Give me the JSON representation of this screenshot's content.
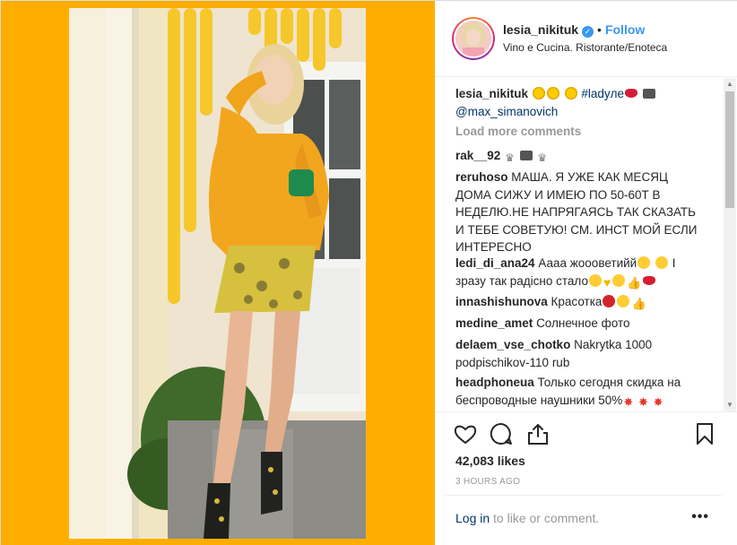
{
  "post": {
    "username": "lesia_nikituk",
    "follow_label": "Follow",
    "separator": "•",
    "location": "Vino e Cucina. Ristorante/Enoteca",
    "caption": {
      "username": "lesia_nikituk",
      "hashtag": "#ladyле",
      "mention": "@max_simanovich"
    },
    "load_more": "Load more comments",
    "comments": [
      {
        "user": "rak__92",
        "text": ""
      },
      {
        "user": "reruhoso",
        "text": "МАША. Я УЖЕ КАК МЕСЯЦ ДОМА СИЖУ И ИМЕЮ ПО 50-60Т В НЕДЕЛЮ.НЕ НАПРЯГАЯСЬ ТАК СКАЗАТЬ И ТЕБЕ СОВЕТУЮ! СМ. ИНСТ МОЙ ЕСЛИ ИНТЕРЕСНО"
      },
      {
        "user": "ledi_di_ana24",
        "text": "Аааа жоооветийй",
        "text2": "І зразу так радісно стало"
      },
      {
        "user": "innashishunova",
        "text": "Красотка"
      },
      {
        "user": "medine_amet",
        "text": "Солнечное фото"
      },
      {
        "user": "delaem_vse_chotko",
        "text": "Nakrytka 1000 podpischikov-110 rub"
      },
      {
        "user": "headphoneua",
        "text": "Только сегодня скидка на беспроводные наушники 50%"
      }
    ],
    "likes": "42,083 likes",
    "time": "3 HOURS AGO",
    "login_link": "Log in",
    "login_rest": " to like or comment.",
    "more_label": "•••"
  },
  "icons": {
    "verified": "verified-badge-icon",
    "like": "heart-icon",
    "comment": "comment-icon",
    "share": "share-icon",
    "save": "bookmark-icon",
    "more": "more-options-icon"
  },
  "colors": {
    "media_background": "#ffae00",
    "accent_blue": "#3897f0",
    "link_dark": "#003569",
    "muted": "#999999"
  }
}
